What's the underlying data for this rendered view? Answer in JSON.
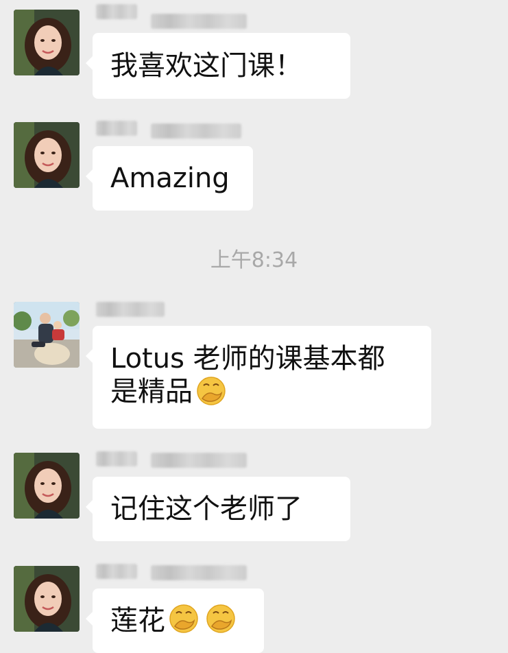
{
  "messages": [
    {
      "text": "我喜欢这门课！"
    },
    {
      "text": "Amazing"
    },
    {
      "line1": "Lotus 老师的课基本都",
      "line2": "是精品"
    },
    {
      "text": "记住这个老师了"
    },
    {
      "text": "莲花"
    }
  ],
  "timestamp": "上午8:34",
  "icons": {
    "avatar_woman": "avatar-woman-icon",
    "avatar_outdoor": "avatar-outdoor-icon",
    "thinking_emoji": "face-hand-over-mouth-emoji"
  },
  "colors": {
    "background": "#ededed",
    "bubble": "#ffffff",
    "time_text": "#a8a8a8",
    "emoji": "#f5c542"
  }
}
